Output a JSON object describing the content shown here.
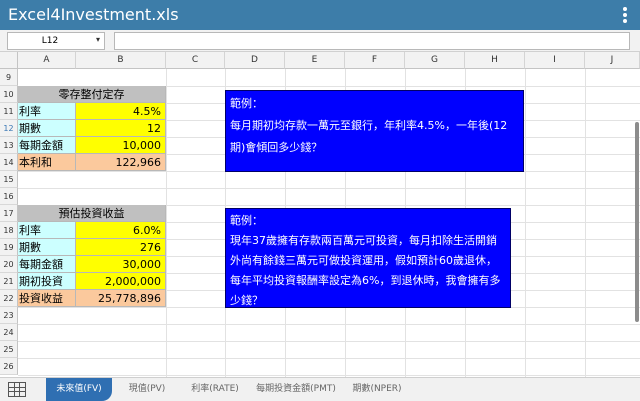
{
  "window": {
    "title": "Excel4Investment.xls",
    "menu_icon": "overflow-menu-icon"
  },
  "formula_bar": {
    "name_box": "L12",
    "formula": ""
  },
  "columns": [
    "A",
    "B",
    "C",
    "D",
    "E",
    "F",
    "G",
    "H",
    "I",
    "J"
  ],
  "rows": [
    "9",
    "10",
    "11",
    "12",
    "13",
    "14",
    "15",
    "16",
    "17",
    "18",
    "19",
    "20",
    "21",
    "22",
    "23",
    "24",
    "25",
    "26"
  ],
  "active_row": "12",
  "table1": {
    "header": "零存整付定存",
    "rows": [
      {
        "label": "利率",
        "value": "4.5%"
      },
      {
        "label": "期數",
        "value": "12"
      },
      {
        "label": "每期金額",
        "value": "10,000"
      },
      {
        "label": "本利和",
        "value": "122,966"
      }
    ]
  },
  "table2": {
    "header": "預估投資收益",
    "rows": [
      {
        "label": "利率",
        "value": "6.0%"
      },
      {
        "label": "期數",
        "value": "276"
      },
      {
        "label": "每期金額",
        "value": "30,000"
      },
      {
        "label": "期初投資",
        "value": "2,000,000"
      },
      {
        "label": "投資收益",
        "value": "25,778,896"
      }
    ]
  },
  "note1": {
    "title": "範例：",
    "body": "每月期初均存款一萬元至銀行，年利率4.5%，一年後(12期)會傾回多少錢？"
  },
  "note2": {
    "title": "範例：",
    "body": "現年37歲擁有存款兩百萬元可投資，每月扣除生活開銷外尚有餘錢三萬元可做投資運用，假如預計60歲退休，每年平均投資報酬率設定為6%，到退休時，我會擁有多少錢？"
  },
  "tabs": [
    "未來值(FV)",
    "現值(PV)",
    "利率(RATE)",
    "每期投資金額(PMT)",
    "期數(NPER)"
  ],
  "active_tab": "未來值(FV)",
  "colors": {
    "title_bar": "#3d7da9",
    "active_tab": "#2f6fb2",
    "note_bg": "#0000ff",
    "cyan": "#ccffff",
    "yellow": "#ffff00",
    "orange": "#fbc99d",
    "header_gray": "#c0c0c0"
  }
}
